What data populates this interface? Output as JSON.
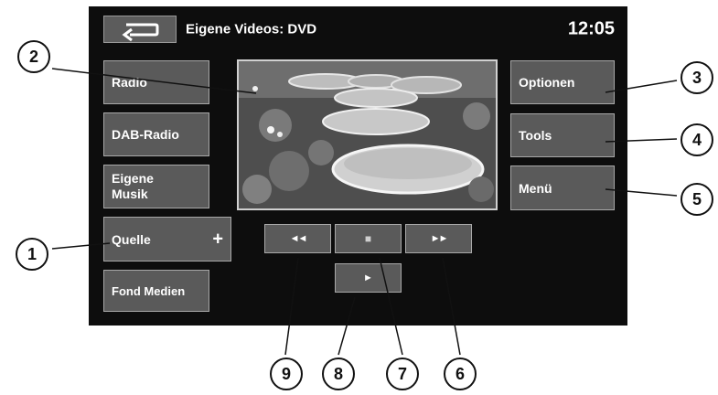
{
  "header": {
    "title": "Eigene Videos: DVD",
    "time": "12:05"
  },
  "left_menu": {
    "radio": "Radio",
    "dab_radio": "DAB-Radio",
    "own_music": "Eigene\nMusik",
    "source": "Quelle",
    "source_plus": "+",
    "rear_media": "Fond Medien"
  },
  "right_menu": {
    "options": "Optionen",
    "tools": "Tools",
    "menu": "Menü"
  },
  "playback": {
    "prev": "◄◄",
    "stop": "■",
    "next": "►►",
    "play": "►"
  },
  "callouts": [
    "1",
    "2",
    "3",
    "4",
    "5",
    "6",
    "7",
    "8",
    "9"
  ],
  "icons": {
    "back": "back-arrow-icon"
  }
}
